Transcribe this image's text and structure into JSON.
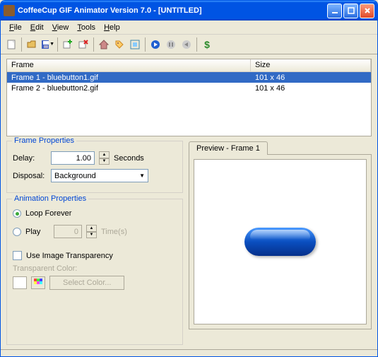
{
  "window": {
    "title": "CoffeeCup GIF Animator Version 7.0 - [UNTITLED]"
  },
  "menu": {
    "file": "File",
    "edit": "Edit",
    "view": "View",
    "tools": "Tools",
    "help": "Help"
  },
  "list": {
    "headers": {
      "frame": "Frame",
      "size": "Size"
    },
    "rows": [
      {
        "frame": "Frame 1 - bluebutton1.gif",
        "size": "101 x 46",
        "selected": true
      },
      {
        "frame": "Frame 2 - bluebutton2.gif",
        "size": "101 x 46",
        "selected": false
      }
    ]
  },
  "frameProps": {
    "title": "Frame Properties",
    "delayLabel": "Delay:",
    "delayValue": "1.00",
    "delayUnit": "Seconds",
    "disposalLabel": "Disposal:",
    "disposalValue": "Background"
  },
  "animProps": {
    "title": "Animation Properties",
    "loopLabel": "Loop Forever",
    "playLabel": "Play",
    "playValue": "0",
    "playUnit": "Time(s)",
    "transparencyLabel": "Use Image Transparency",
    "transColorLabel": "Transparent Color:",
    "selectColorBtn": "Select Color..."
  },
  "preview": {
    "tabLabel": "Preview - Frame 1"
  },
  "icons": {
    "new": "new-file-icon",
    "open": "open-folder-icon",
    "save": "save-icon",
    "add": "add-frame-icon",
    "remove": "remove-frame-icon",
    "home": "home-icon",
    "tag": "tag-icon",
    "shrink": "resize-icon",
    "play": "play-icon",
    "pause": "pause-icon",
    "stop": "stop-icon",
    "dollar": "buy-icon"
  }
}
